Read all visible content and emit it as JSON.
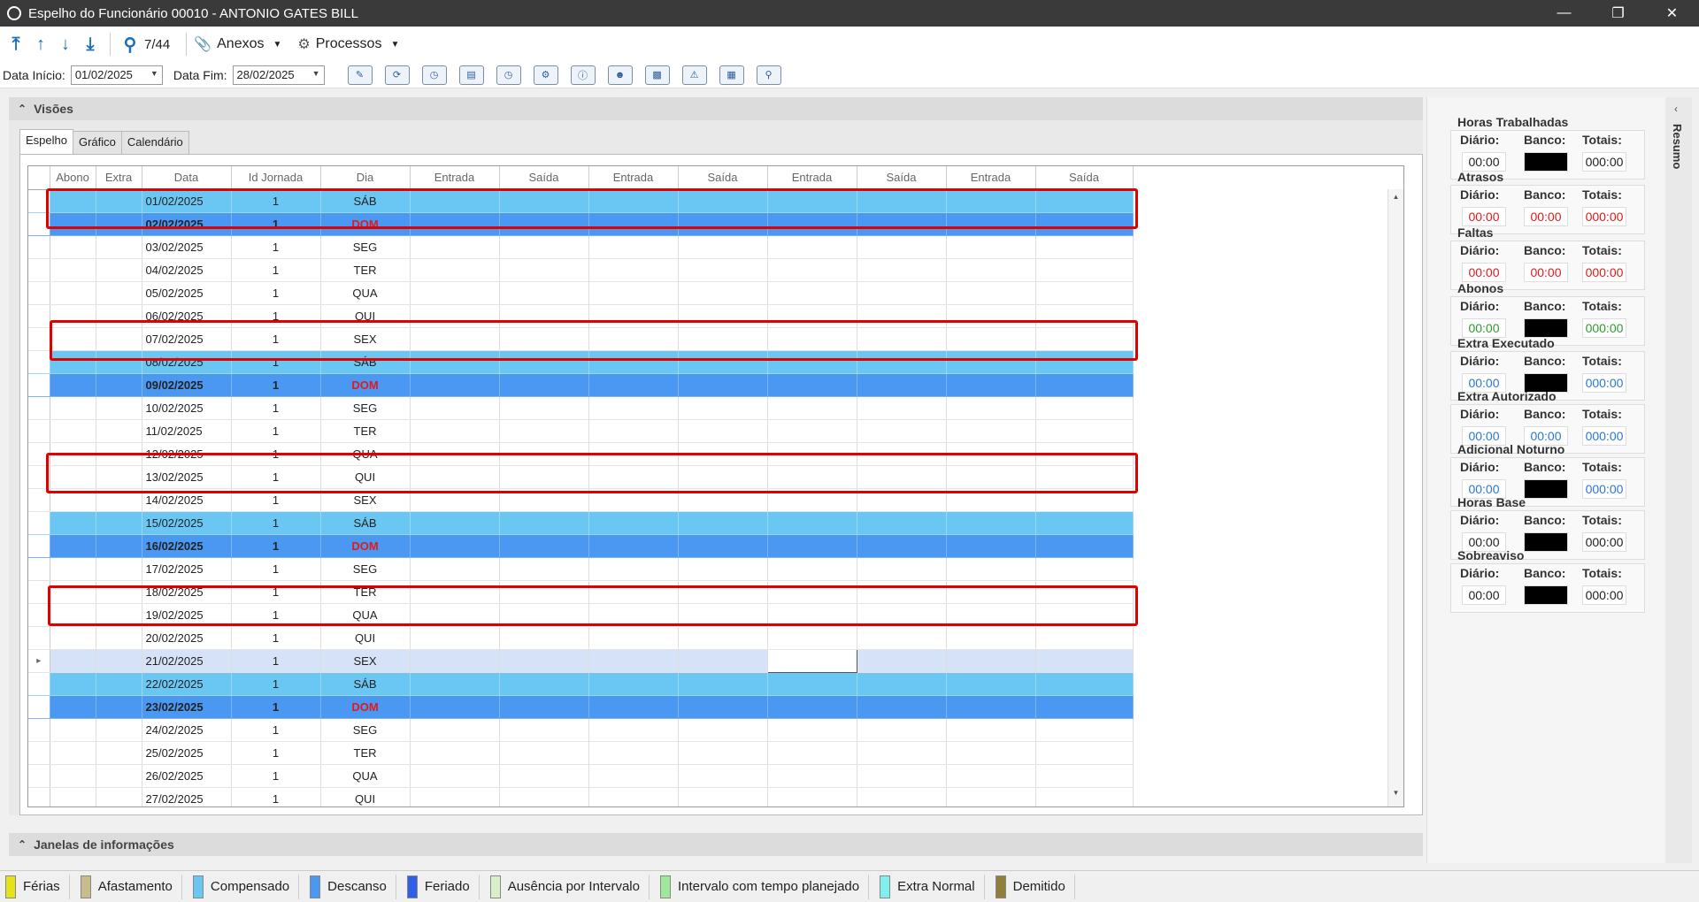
{
  "window": {
    "title": "Espelho do Funcionário 00010 - ANTONIO GATES BILL"
  },
  "toolbar": {
    "record_counter": "7/44",
    "anexos_label": "Anexos",
    "processos_label": "Processos"
  },
  "filters": {
    "data_inicio_label": "Data Início:",
    "data_inicio_value": "01/02/2025",
    "data_fim_label": "Data Fim:",
    "data_fim_value": "28/02/2025"
  },
  "visoes": {
    "header": "Visões",
    "tabs": [
      "Espelho",
      "Gráfico",
      "Calendário"
    ]
  },
  "grid": {
    "columns": [
      "Abono",
      "Extra",
      "Data",
      "Id Jornada",
      "Dia",
      "Entrada",
      "Saída",
      "Entrada",
      "Saída",
      "Entrada",
      "Saída",
      "Entrada",
      "Saída"
    ],
    "rows": [
      {
        "data": "01/02/2025",
        "id": "1",
        "dia": "SÁB",
        "type": "sat"
      },
      {
        "data": "02/02/2025",
        "id": "1",
        "dia": "DOM",
        "type": "dom"
      },
      {
        "data": "03/02/2025",
        "id": "1",
        "dia": "SEG",
        "type": ""
      },
      {
        "data": "04/02/2025",
        "id": "1",
        "dia": "TER",
        "type": ""
      },
      {
        "data": "05/02/2025",
        "id": "1",
        "dia": "QUA",
        "type": ""
      },
      {
        "data": "06/02/2025",
        "id": "1",
        "dia": "QUI",
        "type": ""
      },
      {
        "data": "07/02/2025",
        "id": "1",
        "dia": "SEX",
        "type": ""
      },
      {
        "data": "08/02/2025",
        "id": "1",
        "dia": "SÁB",
        "type": "sat"
      },
      {
        "data": "09/02/2025",
        "id": "1",
        "dia": "DOM",
        "type": "dom"
      },
      {
        "data": "10/02/2025",
        "id": "1",
        "dia": "SEG",
        "type": ""
      },
      {
        "data": "11/02/2025",
        "id": "1",
        "dia": "TER",
        "type": ""
      },
      {
        "data": "12/02/2025",
        "id": "1",
        "dia": "QUA",
        "type": ""
      },
      {
        "data": "13/02/2025",
        "id": "1",
        "dia": "QUI",
        "type": ""
      },
      {
        "data": "14/02/2025",
        "id": "1",
        "dia": "SEX",
        "type": ""
      },
      {
        "data": "15/02/2025",
        "id": "1",
        "dia": "SÁB",
        "type": "sat"
      },
      {
        "data": "16/02/2025",
        "id": "1",
        "dia": "DOM",
        "type": "dom"
      },
      {
        "data": "17/02/2025",
        "id": "1",
        "dia": "SEG",
        "type": ""
      },
      {
        "data": "18/02/2025",
        "id": "1",
        "dia": "TER",
        "type": ""
      },
      {
        "data": "19/02/2025",
        "id": "1",
        "dia": "QUA",
        "type": ""
      },
      {
        "data": "20/02/2025",
        "id": "1",
        "dia": "QUI",
        "type": ""
      },
      {
        "data": "21/02/2025",
        "id": "1",
        "dia": "SEX",
        "type": "current"
      },
      {
        "data": "22/02/2025",
        "id": "1",
        "dia": "SÁB",
        "type": "sat"
      },
      {
        "data": "23/02/2025",
        "id": "1",
        "dia": "DOM",
        "type": "dom"
      },
      {
        "data": "24/02/2025",
        "id": "1",
        "dia": "SEG",
        "type": ""
      },
      {
        "data": "25/02/2025",
        "id": "1",
        "dia": "TER",
        "type": ""
      },
      {
        "data": "26/02/2025",
        "id": "1",
        "dia": "QUA",
        "type": ""
      },
      {
        "data": "27/02/2025",
        "id": "1",
        "dia": "QUI",
        "type": ""
      }
    ]
  },
  "janelas": {
    "header": "Janelas de informações"
  },
  "resumo": {
    "label": "Resumo",
    "diario_label": "Diário:",
    "banco_label": "Banco:",
    "totais_label": "Totais:",
    "stats": [
      {
        "title": "Horas Trabalhadas",
        "diario": "00:00",
        "banco": "",
        "totais": "000:00",
        "color": "dark",
        "banco_black": true
      },
      {
        "title": "Atrasos",
        "diario": "00:00",
        "banco": "00:00",
        "totais": "000:00",
        "color": "red",
        "banco_black": false
      },
      {
        "title": "Faltas",
        "diario": "00:00",
        "banco": "00:00",
        "totais": "000:00",
        "color": "red",
        "banco_black": false
      },
      {
        "title": "Abonos",
        "diario": "00:00",
        "banco": "",
        "totais": "000:00",
        "color": "green",
        "banco_black": true
      },
      {
        "title": "Extra Executado",
        "diario": "00:00",
        "banco": "",
        "totais": "000:00",
        "color": "blue",
        "banco_black": true
      },
      {
        "title": "Extra Autorizado",
        "diario": "00:00",
        "banco": "00:00",
        "totais": "000:00",
        "color": "blue",
        "banco_black": false
      },
      {
        "title": "Adicional Noturno",
        "diario": "00:00",
        "banco": "",
        "totais": "000:00",
        "color": "blue",
        "banco_black": true
      },
      {
        "title": "Horas Base",
        "diario": "00:00",
        "banco": "",
        "totais": "000:00",
        "color": "dark",
        "banco_black": true
      },
      {
        "title": "Sobreaviso",
        "diario": "00:00",
        "banco": "",
        "totais": "000:00",
        "color": "dark",
        "banco_black": true
      }
    ]
  },
  "legend": [
    {
      "label": "Férias",
      "color": "#e6e21a"
    },
    {
      "label": "Afastamento",
      "color": "#c9bc8c"
    },
    {
      "label": "Compensado",
      "color": "#6ac6f3"
    },
    {
      "label": "Descanso",
      "color": "#4a98f1"
    },
    {
      "label": "Feriado",
      "color": "#2f5fe8"
    },
    {
      "label": "Ausência por Intervalo",
      "color": "#d9efc9"
    },
    {
      "label": "Intervalo com tempo planejado",
      "color": "#9de89a"
    },
    {
      "label": "Extra Normal",
      "color": "#7ff0ee"
    },
    {
      "label": "Demitido",
      "color": "#8f7f3a"
    }
  ]
}
